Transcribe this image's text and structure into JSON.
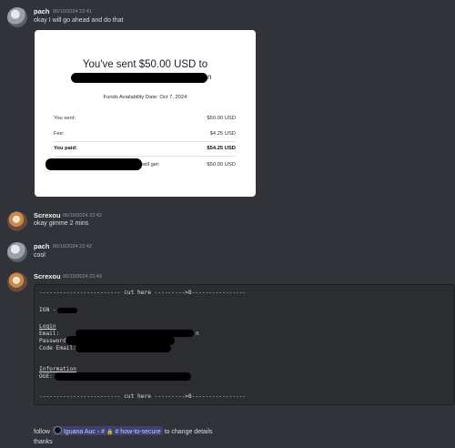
{
  "messages": [
    {
      "user": "pach",
      "time": "06/10/2024 22:41",
      "text": "okay I will go ahead and do that"
    },
    {
      "user": "Screxou",
      "time": "06/10/2024 22:42",
      "text": "okay gimme 2 mins"
    },
    {
      "user": "pach",
      "time": "06/10/2024 22:42",
      "text": "cool"
    },
    {
      "user": "Screxou",
      "time": "06/10/2024 22:43"
    }
  ],
  "receipt": {
    "title": "You've sent $50.00 USD to",
    "name_tail": "n",
    "availability": "Funds Availability Date: Oct 7, 2024",
    "rows": [
      {
        "label": "You sent:",
        "value": "$50.00 USD"
      },
      {
        "label": "Fee:",
        "value": "$4.25 USD"
      },
      {
        "label": "You paid:",
        "value": "$54.25 USD"
      },
      {
        "label": "will get:",
        "value": "$50.00 USD"
      }
    ]
  },
  "codeblock": {
    "header": "------------------------ cut here --------->8----------------",
    "ign": "IGN -",
    "login": "Login",
    "email": "Email:",
    "email_tail": "n",
    "password": "Password:",
    "code_email": "Code Email:",
    "information": "Information",
    "oge": "OGE:",
    "footer": "------------------------ cut here --------->8----------------"
  },
  "followup": {
    "follow": "follow",
    "server": "Iguana Auc",
    "sep": "›",
    "hash": "#",
    "lock": "🔒",
    "channel": "how-to-secure",
    "rest": "to change details",
    "thanks": "thanks"
  }
}
